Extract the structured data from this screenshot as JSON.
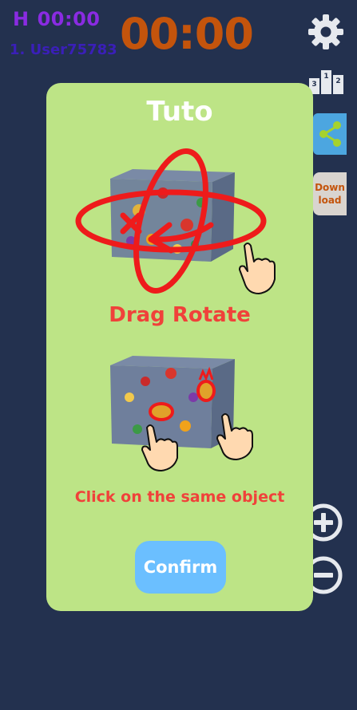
{
  "hud": {
    "best_label": "H",
    "best_time": "00:00",
    "player_rank": "1. User75783",
    "timer": "00:00"
  },
  "side_buttons": {
    "settings_icon": "gear-icon",
    "leaderboard_icon": "podium-icon",
    "leaderboard_ranks": [
      "3",
      "1",
      "2"
    ],
    "share_icon": "share-icon",
    "download_label": "Down\nload",
    "zoom_in_icon": "plus-circle-icon",
    "zoom_out_icon": "minus-circle-icon"
  },
  "tutorial": {
    "title": "Tuto",
    "step1_caption": "Drag Rotate",
    "step2_caption": "Click on the same object",
    "confirm_label": "Confirm"
  },
  "colors": {
    "background": "#23314f",
    "panel": "#bde486",
    "timer": "#c4540c",
    "accent_red": "#f0413a",
    "confirm": "#6bbfff",
    "share": "#4ca6e0"
  }
}
